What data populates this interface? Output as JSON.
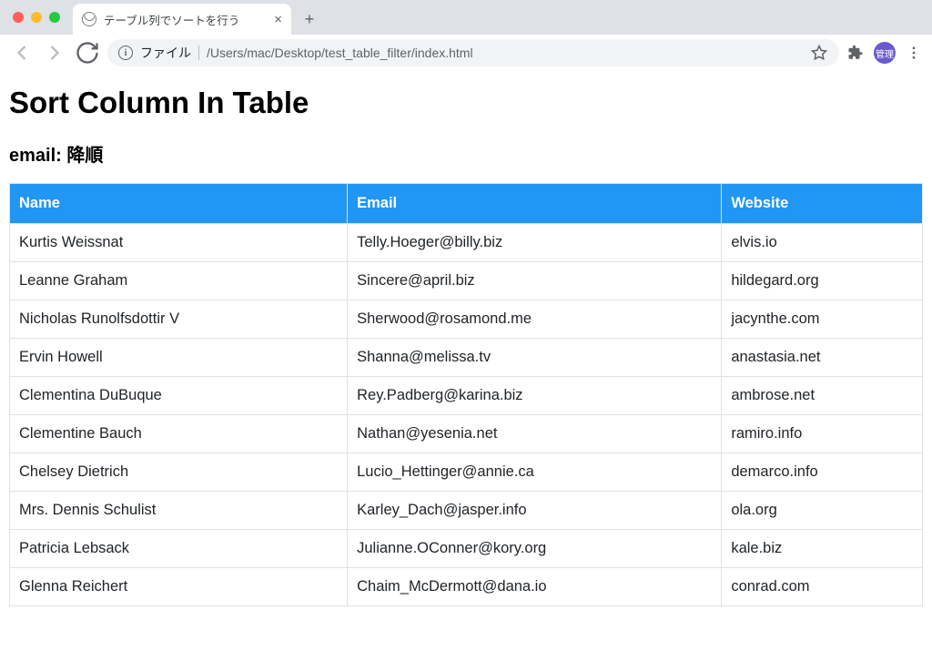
{
  "browser": {
    "tab_title": "テーブル列でソートを行う",
    "file_label": "ファイル",
    "url_path": "/Users/mac/Desktop/test_table_filter/index.html",
    "profile_label": "管理"
  },
  "page": {
    "heading": "Sort Column In Table",
    "sort_status": "email: 降順"
  },
  "table": {
    "headers": [
      "Name",
      "Email",
      "Website"
    ],
    "rows": [
      {
        "name": "Kurtis Weissnat",
        "email": "Telly.Hoeger@billy.biz",
        "website": "elvis.io"
      },
      {
        "name": "Leanne Graham",
        "email": "Sincere@april.biz",
        "website": "hildegard.org"
      },
      {
        "name": "Nicholas Runolfsdottir V",
        "email": "Sherwood@rosamond.me",
        "website": "jacynthe.com"
      },
      {
        "name": "Ervin Howell",
        "email": "Shanna@melissa.tv",
        "website": "anastasia.net"
      },
      {
        "name": "Clementina DuBuque",
        "email": "Rey.Padberg@karina.biz",
        "website": "ambrose.net"
      },
      {
        "name": "Clementine Bauch",
        "email": "Nathan@yesenia.net",
        "website": "ramiro.info"
      },
      {
        "name": "Chelsey Dietrich",
        "email": "Lucio_Hettinger@annie.ca",
        "website": "demarco.info"
      },
      {
        "name": "Mrs. Dennis Schulist",
        "email": "Karley_Dach@jasper.info",
        "website": "ola.org"
      },
      {
        "name": "Patricia Lebsack",
        "email": "Julianne.OConner@kory.org",
        "website": "kale.biz"
      },
      {
        "name": "Glenna Reichert",
        "email": "Chaim_McDermott@dana.io",
        "website": "conrad.com"
      }
    ]
  }
}
